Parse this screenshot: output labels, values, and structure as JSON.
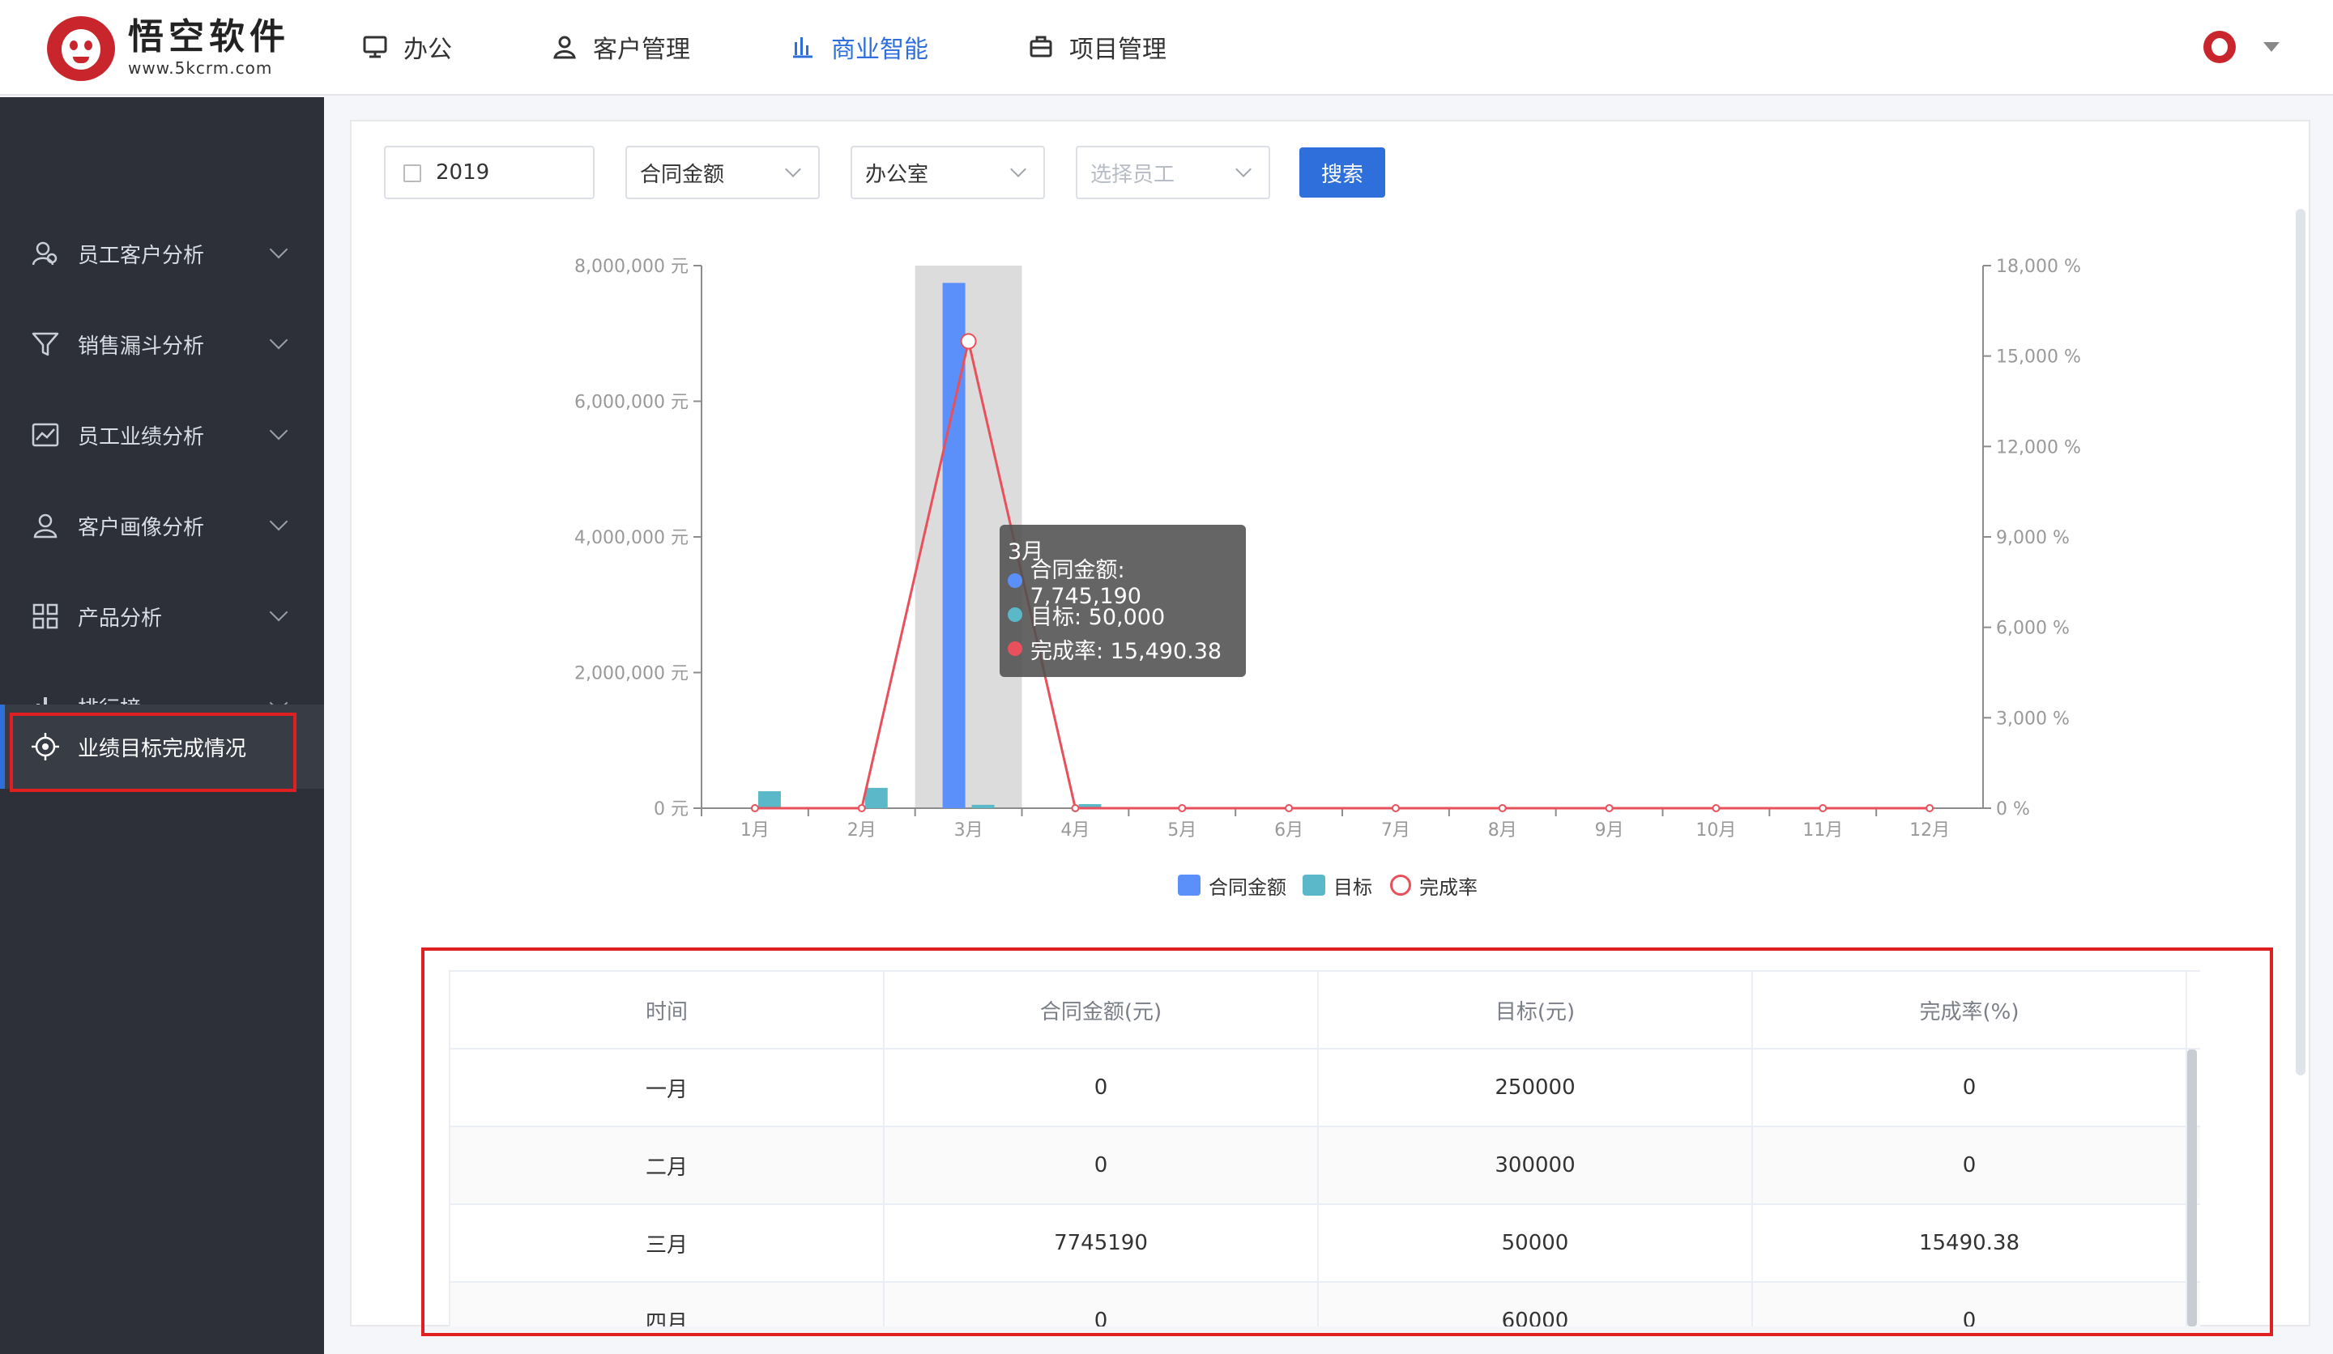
{
  "header": {
    "logo_title": "悟空软件",
    "logo_sub": "www.5kcrm.com",
    "nav": [
      {
        "label": "办公",
        "icon": "monitor-icon",
        "active": false
      },
      {
        "label": "客户管理",
        "icon": "user-icon",
        "active": false
      },
      {
        "label": "商业智能",
        "icon": "bar-chart-icon",
        "active": true
      },
      {
        "label": "项目管理",
        "icon": "briefcase-icon",
        "active": false
      }
    ]
  },
  "sidebar": {
    "items": [
      {
        "label": "员工客户分析",
        "icon": "employee-customer-icon"
      },
      {
        "label": "销售漏斗分析",
        "icon": "funnel-icon"
      },
      {
        "label": "员工业绩分析",
        "icon": "trend-icon"
      },
      {
        "label": "客户画像分析",
        "icon": "portrait-icon"
      },
      {
        "label": "产品分析",
        "icon": "grid-icon"
      },
      {
        "label": "排行榜",
        "icon": "ranking-icon"
      },
      {
        "label": "业绩目标完成情况",
        "icon": "target-icon",
        "active": true
      }
    ]
  },
  "filters": {
    "year": "2019",
    "type": "合同金额",
    "dept": "办公室",
    "employee_placeholder": "选择员工",
    "search_label": "搜索"
  },
  "colors": {
    "primary": "#2e6fdc",
    "bar_amount": "#5b8ff9",
    "bar_target": "#5ab8c9",
    "line_rate": "#e8505b",
    "highlight": "#e02020"
  },
  "chart_data": {
    "type": "bar",
    "categories": [
      "1月",
      "2月",
      "3月",
      "4月",
      "5月",
      "6月",
      "7月",
      "8月",
      "9月",
      "10月",
      "11月",
      "12月"
    ],
    "series": [
      {
        "name": "合同金额",
        "type": "bar",
        "axis": "left",
        "values": [
          0,
          0,
          7745190,
          0,
          0,
          0,
          0,
          0,
          0,
          0,
          0,
          0
        ]
      },
      {
        "name": "目标",
        "type": "bar",
        "axis": "left",
        "values": [
          250000,
          300000,
          50000,
          60000,
          0,
          0,
          0,
          0,
          0,
          0,
          0,
          0
        ]
      },
      {
        "name": "完成率",
        "type": "line",
        "axis": "right",
        "values": [
          0,
          0,
          15490.38,
          0,
          0,
          0,
          0,
          0,
          0,
          0,
          0,
          0
        ]
      }
    ],
    "y_left": {
      "ticks": [
        "0 元",
        "2,000,000 元",
        "4,000,000 元",
        "6,000,000 元",
        "8,000,000 元"
      ],
      "range": [
        0,
        8000000
      ]
    },
    "y_right": {
      "ticks": [
        "0 %",
        "3,000 %",
        "6,000 %",
        "9,000 %",
        "12,000 %",
        "15,000 %",
        "18,000 %"
      ],
      "range": [
        0,
        18000
      ]
    },
    "highlighted_category": "3月",
    "legend": [
      "合同金额",
      "目标",
      "完成率"
    ],
    "legend_position": "bottom"
  },
  "tooltip": {
    "title": "3月",
    "rows": [
      {
        "text": "合同金额: 7,745,190",
        "color": "#5b8ff9"
      },
      {
        "text": "目标: 50,000",
        "color": "#5ab8c9"
      },
      {
        "text": "完成率: 15,490.38",
        "color": "#e8505b"
      }
    ]
  },
  "table": {
    "headers": [
      "时间",
      "合同金额(元)",
      "目标(元)",
      "完成率(%)"
    ],
    "rows": [
      [
        "一月",
        "0",
        "250000",
        "0"
      ],
      [
        "二月",
        "0",
        "300000",
        "0"
      ],
      [
        "三月",
        "7745190",
        "50000",
        "15490.38"
      ],
      [
        "四月",
        "0",
        "60000",
        "0"
      ]
    ]
  }
}
